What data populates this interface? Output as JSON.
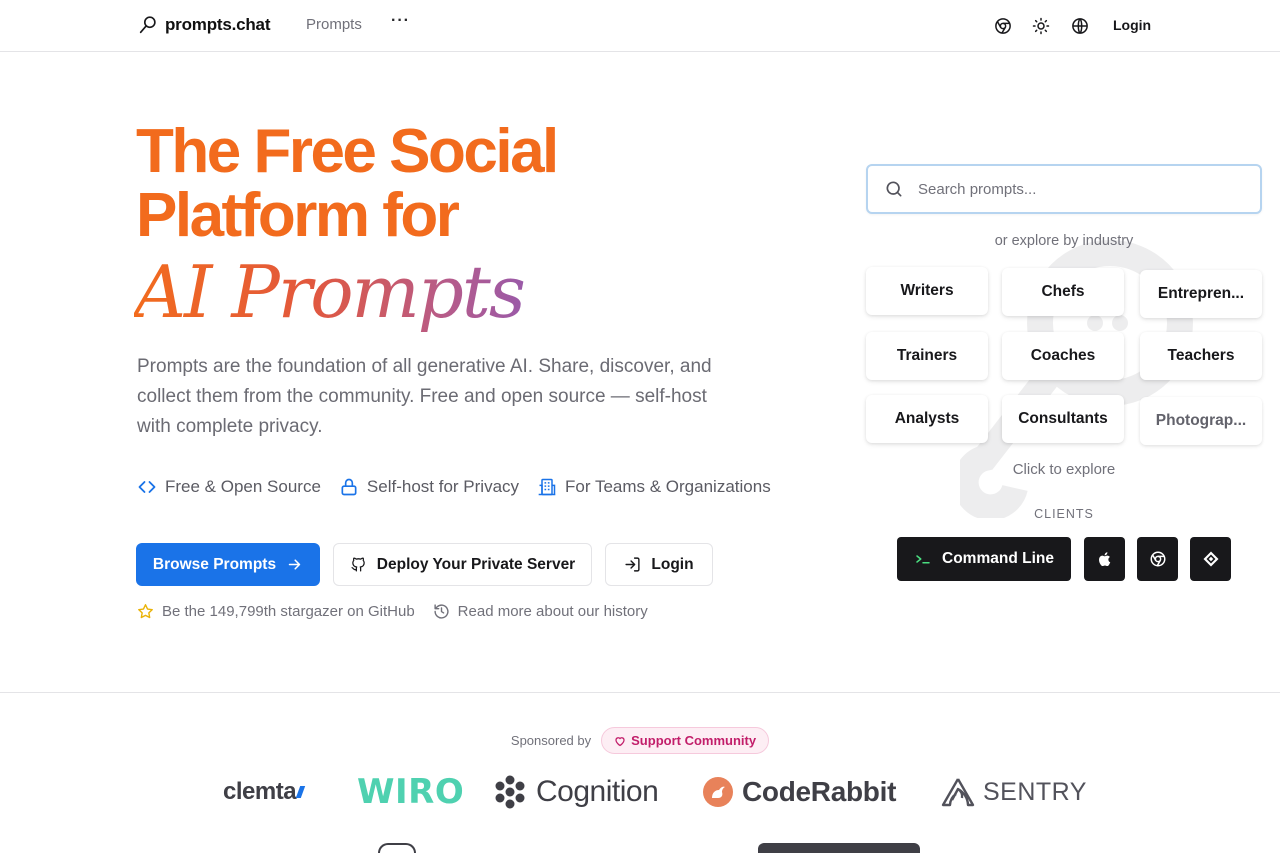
{
  "header": {
    "brand": "prompts.chat",
    "nav_prompts": "Prompts",
    "nav_more": "···",
    "icons": [
      "chrome-icon",
      "sun-icon",
      "globe-icon"
    ],
    "login": "Login"
  },
  "hero": {
    "title_line1": "The Free Social",
    "title_line2": "Platform for",
    "title_script": "AI Prompts",
    "description": "Prompts are the foundation of all generative AI. Share, discover, and collect them from the community. Free and open source — self-host with complete privacy.",
    "features": [
      {
        "icon": "code-icon",
        "label": "Free & Open Source"
      },
      {
        "icon": "lock-icon",
        "label": "Self-host for Privacy"
      },
      {
        "icon": "building-icon",
        "label": "For Teams & Organizations"
      }
    ],
    "buttons": {
      "browse": "Browse Prompts",
      "deploy": "Deploy Your Private Server",
      "login": "Login"
    },
    "stargazer": "Be the 149,799th stargazer on GitHub",
    "history": "Read more about our history"
  },
  "explore": {
    "search_placeholder": "Search prompts...",
    "industry_label": "or explore by industry",
    "industries": [
      "Writers",
      "Chefs",
      "Entrepren...",
      "Trainers",
      "Coaches",
      "Teachers",
      "Analysts",
      "Consultants",
      "Photograp..."
    ],
    "click_label": "Click to explore",
    "clients_label": "CLIENTS",
    "clients": {
      "command_line": "Command Line",
      "icons": [
        "apple-icon",
        "chrome-icon",
        "raycast-icon"
      ]
    }
  },
  "sponsors": {
    "label": "Sponsored by",
    "support": "Support Community",
    "logos": [
      "clemta",
      "WIRO",
      "Cognition",
      "CodeRabbit",
      "SENTRY"
    ]
  },
  "colors": {
    "accent_orange": "#f26b1d",
    "primary_blue": "#1a73e8",
    "feature_blue": "#1a73e8",
    "dark_button": "#18181b",
    "wiro_green": "#4fd1b0",
    "pill_pink": "#c21e6a"
  }
}
